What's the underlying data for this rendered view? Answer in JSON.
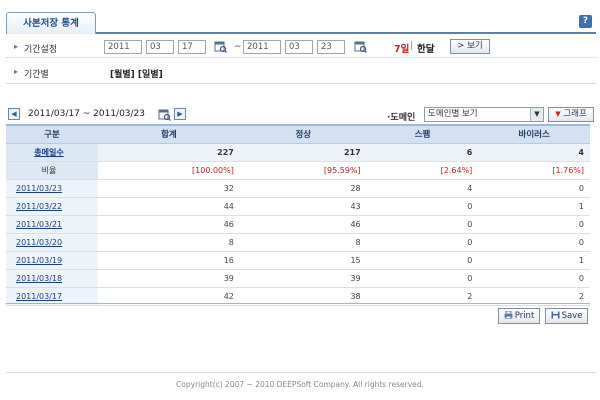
{
  "header": {
    "tab_title": "사본저장 통계",
    "help_label": "?"
  },
  "filter": {
    "period_label": "기간설정",
    "start": {
      "year": "2011",
      "month": "03",
      "day": "17"
    },
    "end": {
      "year": "2011",
      "month": "03",
      "day": "23"
    },
    "tilde": "~",
    "quick_7day": "7일",
    "quick_sep": "|",
    "quick_month": "한달",
    "view_button": "> 보기",
    "period_type_label": "기간별",
    "period_links": "[월별] [일별]"
  },
  "nav": {
    "prev": "◀",
    "next": "▶",
    "range_text": "2011/03/17 ~ 2011/03/23",
    "domain_label": "도메인",
    "domain_select_value": "도메인별 보기",
    "graph_button": "그래프"
  },
  "table": {
    "headers": [
      "구분",
      "합계",
      "정상",
      "스팸",
      "바이러스"
    ],
    "total": {
      "label": "총메일수",
      "values": [
        "227",
        "217",
        "6",
        "4"
      ]
    },
    "ratio": {
      "label": "비율",
      "values": [
        "[100.00%]",
        "[95.59%]",
        "[2.64%]",
        "[1.76%]"
      ]
    },
    "rows": [
      {
        "date": "2011/03/23",
        "values": [
          "32",
          "28",
          "4",
          "0"
        ]
      },
      {
        "date": "2011/03/22",
        "values": [
          "44",
          "43",
          "0",
          "1"
        ]
      },
      {
        "date": "2011/03/21",
        "values": [
          "46",
          "46",
          "0",
          "0"
        ]
      },
      {
        "date": "2011/03/20",
        "values": [
          "8",
          "8",
          "0",
          "0"
        ]
      },
      {
        "date": "2011/03/19",
        "values": [
          "16",
          "15",
          "0",
          "1"
        ]
      },
      {
        "date": "2011/03/18",
        "values": [
          "39",
          "39",
          "0",
          "0"
        ]
      },
      {
        "date": "2011/03/17",
        "values": [
          "42",
          "38",
          "2",
          "2"
        ]
      }
    ]
  },
  "actions": {
    "print": "Print",
    "save": "Save"
  },
  "footer": {
    "copyright": "Copyright(c) 2007 ~ 2010 DEEPSoft Company. All rights reserved."
  },
  "colors": {
    "accent": "#5b7fae",
    "header_bg": "#d4e1f2",
    "alert_red": "#cc1f1f"
  }
}
